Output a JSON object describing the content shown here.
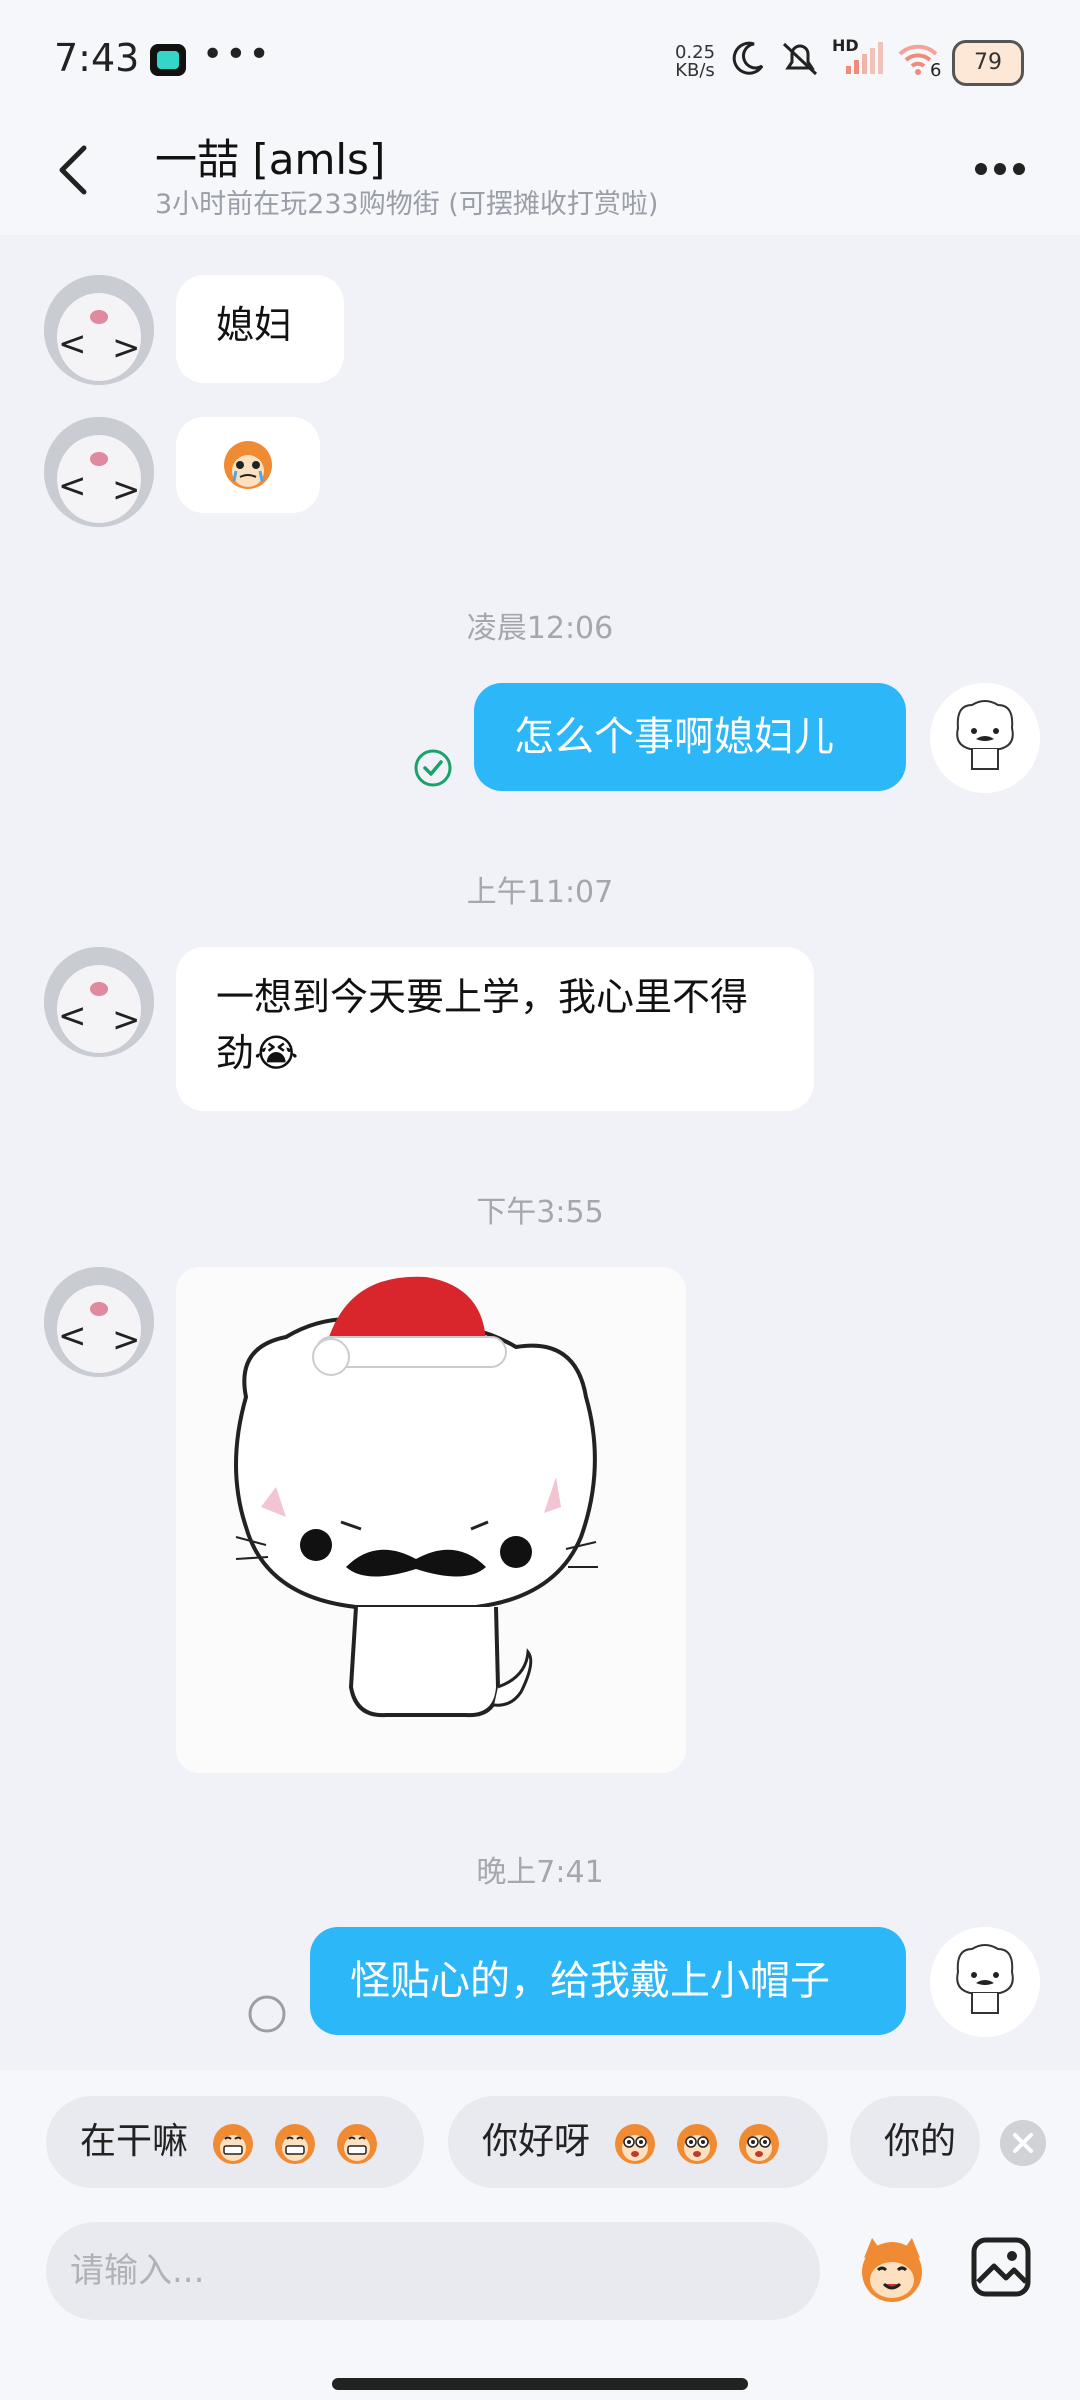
{
  "status_bar": {
    "time": "7:43",
    "speed": "0.25",
    "speed_unit": "KB/s",
    "network": "HD",
    "wifi_num": "6",
    "battery": "79"
  },
  "header": {
    "title": "一喆 [amls]",
    "subtitle": "3小时前在玩233购物街 (可摆摊收打赏啦)"
  },
  "messages": {
    "m1_text": "媳妇",
    "ts1": "凌晨12:06",
    "m3_text": "怎么个事啊媳妇儿",
    "ts2": "上午11:07",
    "m4_text": "一想到今天要上学，我心里不得劲😭",
    "ts3": "下午3:55",
    "ts4": "晚上7:41",
    "m6_text": "怪贴心的，给我戴上小帽子"
  },
  "quick_replies": {
    "chip1": "在干嘛",
    "chip2": "你好呀",
    "chip3": "你的"
  },
  "input": {
    "placeholder": "请输入..."
  },
  "colors": {
    "accent": "#2bb7f8",
    "read_check": "#19a36a"
  }
}
